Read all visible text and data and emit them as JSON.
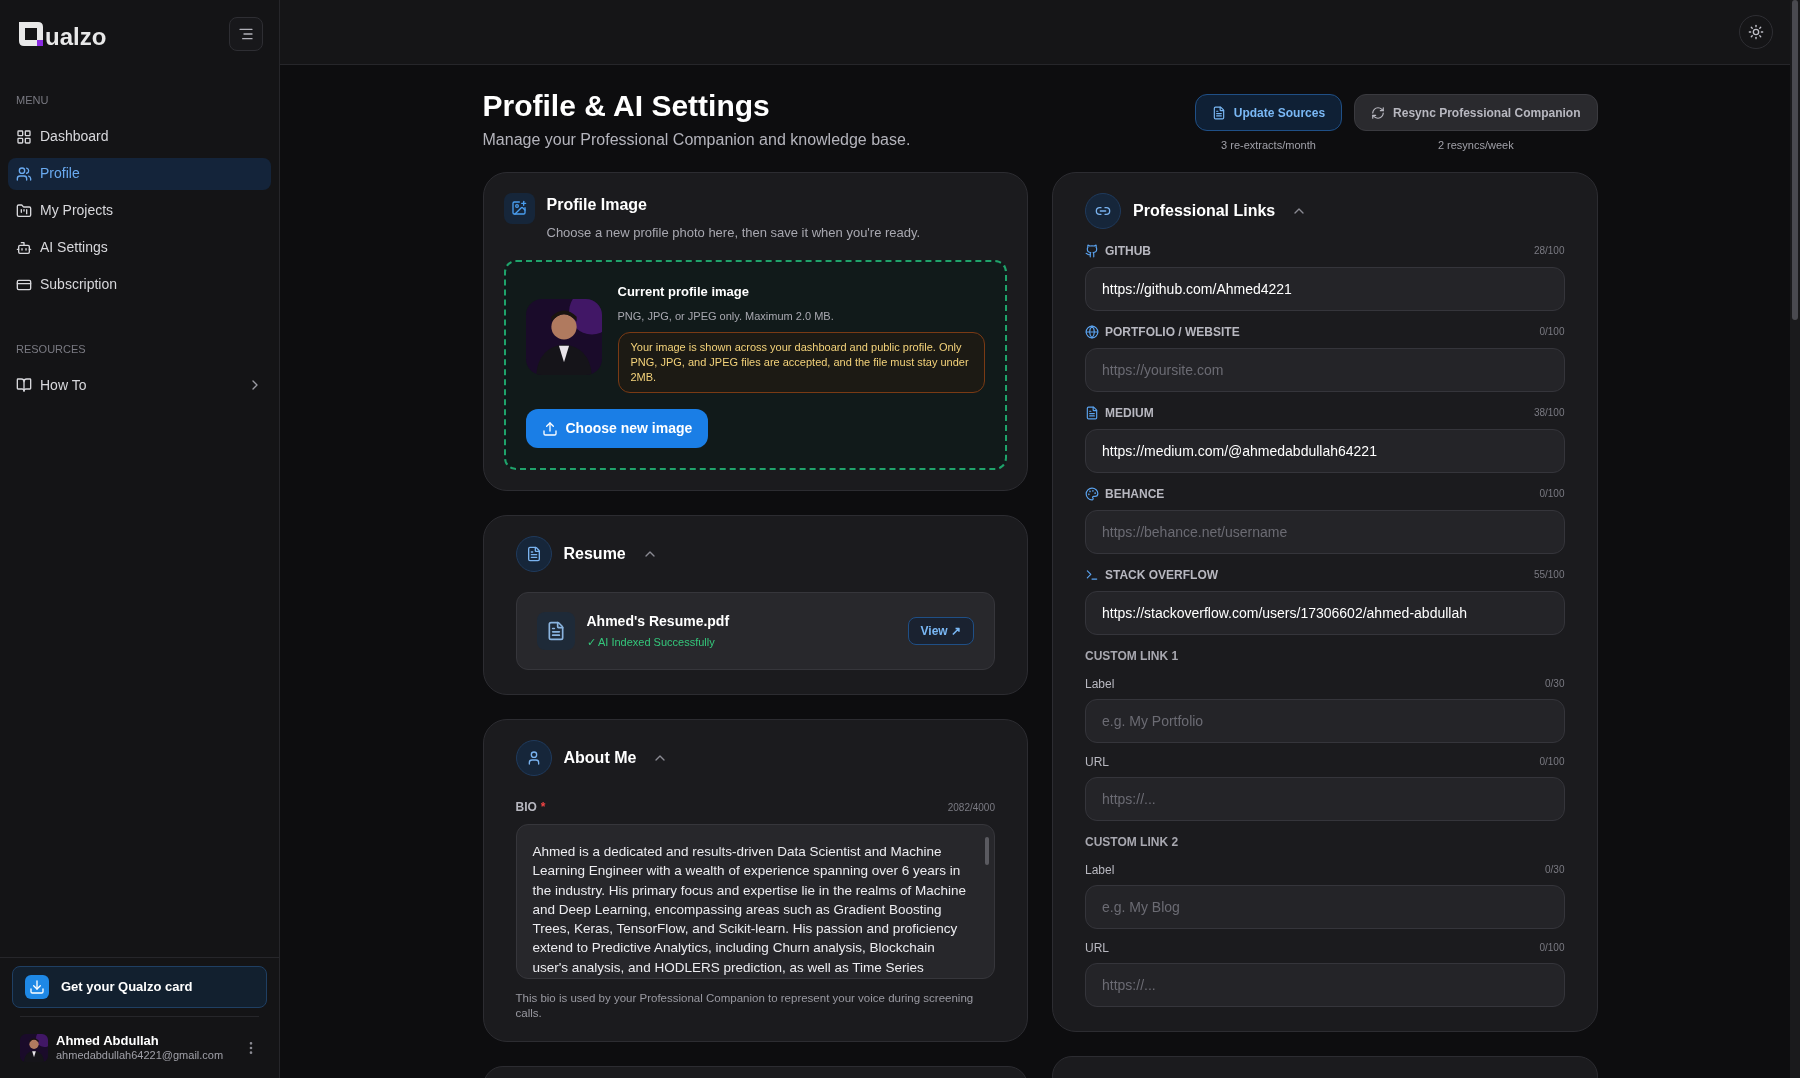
{
  "sidebar": {
    "logo_text": "ualzo",
    "menu_heading": "MENU",
    "menu": [
      {
        "label": "Dashboard",
        "selected": false
      },
      {
        "label": "Profile",
        "selected": true
      },
      {
        "label": "My Projects",
        "selected": false
      },
      {
        "label": "AI Settings",
        "selected": false
      },
      {
        "label": "Subscription",
        "selected": false
      }
    ],
    "resources_heading": "RESOURCES",
    "resources": [
      {
        "label": "How To"
      }
    ],
    "promo": "Get your Qualzo card",
    "user": {
      "name": "Ahmed Abdullah",
      "email": "ahmedabdullah64221@gmail.com"
    }
  },
  "page": {
    "title": "Profile & AI Settings",
    "subtitle": "Manage your Professional Companion and knowledge base.",
    "actions": [
      {
        "label": "Update Sources",
        "note": "3 re-extracts/month",
        "kind": "primary"
      },
      {
        "label": "Resync Professional Companion",
        "note": "2 resyncs/week",
        "kind": "secondary"
      }
    ]
  },
  "profile_image": {
    "title": "Profile Image",
    "subtitle": "Choose a new profile photo here, then save it when you're ready.",
    "current_title": "Current profile image",
    "formats": "PNG, JPG, or JPEG only. Maximum 2.0 MB.",
    "notice": "Your image is shown across your dashboard and public profile. Only PNG, JPG, and JPEG files are accepted, and the file must stay under 2MB.",
    "button": "Choose new image"
  },
  "resume": {
    "title": "Resume",
    "expanded": true,
    "file_name": "Ahmed's Resume.pdf",
    "status": "✓ AI Indexed Successfully",
    "view_button": "View ↗"
  },
  "about": {
    "title": "About Me",
    "expanded": true,
    "bio_label": "BIO",
    "required_mark": "*",
    "count": "2082/4000",
    "bio": "Ahmed is a dedicated and results-driven Data Scientist and Machine Learning Engineer with a wealth of experience spanning over 6 years in the industry. His primary focus and expertise lie in the realms of Machine and Deep Learning, encompassing areas such as Gradient Boosting Trees, Keras, TensorFlow, and Scikit-learn. His passion and proficiency extend to Predictive Analytics, including Churn analysis, Blockchain user's analysis, and HODLERS prediction, as well as Time Series",
    "hint": "This bio is used by your Professional Companion to represent your voice during screening calls."
  },
  "links": {
    "title": "Professional Links",
    "expanded": true,
    "fields": [
      {
        "label": "GITHUB",
        "count": "28/100",
        "value": "https://github.com/Ahmed4221"
      },
      {
        "label": "PORTFOLIO / WEBSITE",
        "count": "0/100",
        "placeholder": "https://yoursite.com"
      },
      {
        "label": "MEDIUM",
        "count": "38/100",
        "value": "https://medium.com/@ahmedabdullah64221"
      },
      {
        "label": "BEHANCE",
        "count": "0/100",
        "placeholder": "https://behance.net/username"
      },
      {
        "label": "STACK OVERFLOW",
        "count": "55/100",
        "value": "https://stackoverflow.com/users/17306602/ahmed-abdullah"
      }
    ],
    "custom": [
      {
        "heading": "CUSTOM LINK 1",
        "fields": [
          {
            "label": "Label",
            "count": "0/30",
            "placeholder": "e.g. My Portfolio"
          },
          {
            "label": "URL",
            "count": "0/100",
            "placeholder": "https://..."
          }
        ]
      },
      {
        "heading": "CUSTOM LINK 2",
        "fields": [
          {
            "label": "Label",
            "count": "0/30",
            "placeholder": "e.g. My Blog"
          },
          {
            "label": "URL",
            "count": "0/100",
            "placeholder": "https://..."
          }
        ]
      }
    ]
  }
}
